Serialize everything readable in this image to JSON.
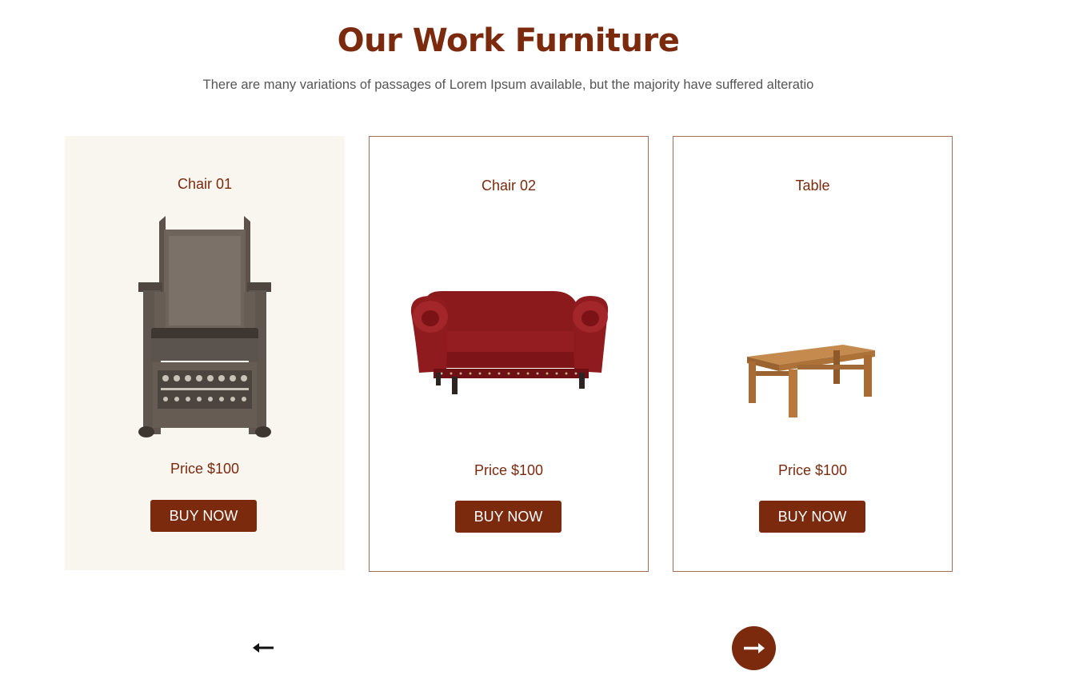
{
  "header": {
    "title": "Our Work Furniture",
    "subtitle": "There are many variations of passages of Lorem Ipsum available, but the majority have suffered alteratio"
  },
  "products": [
    {
      "name": "Chair 01",
      "price": "Price $100",
      "button": "BUY NOW",
      "image": "wooden-throne-chair"
    },
    {
      "name": "Chair 02",
      "price": "Price $100",
      "button": "BUY NOW",
      "image": "red-leather-loveseat"
    },
    {
      "name": "Table",
      "price": "Price $100",
      "button": "BUY NOW",
      "image": "wooden-table"
    }
  ],
  "navigation": {
    "prev_icon": "arrow-left-icon",
    "next_icon": "arrow-right-icon"
  },
  "colors": {
    "brand": "#7b2a0e",
    "active_card_bg": "#f9f5ef",
    "card_border": "#a0705a",
    "subtitle_text": "#555555"
  }
}
